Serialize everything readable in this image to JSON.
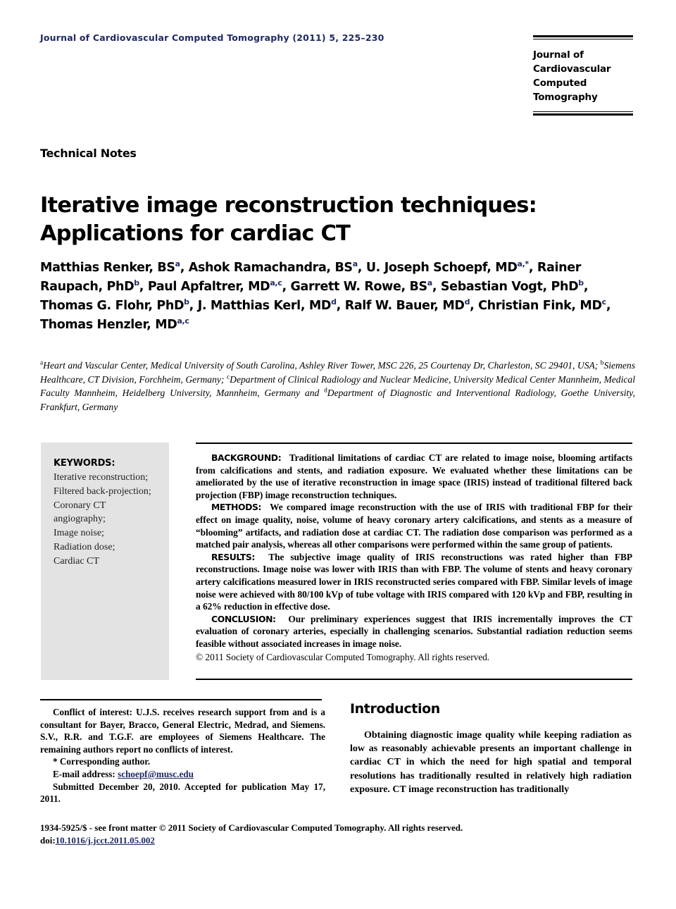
{
  "running_head": "Journal of Cardiovascular Computed Tomography (2011) 5, 225–230",
  "journal_logo": {
    "lines": [
      "Journal of",
      "Cardiovascular",
      "Computed Tomography"
    ]
  },
  "section_type": "Technical Notes",
  "title": "Iterative image reconstruction techniques: Applications for cardiac CT",
  "authors_html": "Matthias Renker, BS<sup>a</sup>, Ashok Ramachandra, BS<sup>a</sup>, U. Joseph Schoepf, MD<sup>a,</sup><sup class=\"star\">*</sup>, Rainer Raupach, PhD<sup>b</sup>, Paul Apfaltrer, MD<sup>a,c</sup>, Garrett W. Rowe, BS<sup>a</sup>, Sebastian Vogt, PhD<sup>b</sup>, Thomas G. Flohr, PhD<sup>b</sup>, J. Matthias Kerl, MD<sup>d</sup>, Ralf W. Bauer, MD<sup>d</sup>, Christian Fink, MD<sup>c</sup>, Thomas Henzler, MD<sup>a,c</sup>",
  "affiliations_html": "<sup>a</sup>Heart and Vascular Center, Medical University of South Carolina, Ashley River Tower, MSC 226, 25 Courtenay Dr, Charleston, SC 29401, USA; <sup>b</sup>Siemens Healthcare, CT Division, Forchheim, Germany; <sup>c</sup>Department of Clinical Radiology and Nuclear Medicine, University Medical Center Mannheim, Medical Faculty Mannheim, Heidelberg University, Mannheim, Germany and <sup>d</sup>Department of Diagnostic and Interventional Radiology, Goethe University, Frankfurt, Germany",
  "keywords": {
    "heading": "KEYWORDS:",
    "items": [
      "Iterative reconstruction;",
      "Filtered back-projection;",
      "Coronary CT",
      "angiography;",
      "Image noise;",
      "Radiation dose;",
      "Cardiac CT"
    ]
  },
  "abstract": {
    "sections": [
      {
        "label": "BACKGROUND:",
        "text": "Traditional limitations of cardiac CT are related to image noise, blooming artifacts from calcifications and stents, and radiation exposure. We evaluated whether these limitations can be ameliorated by the use of iterative reconstruction in image space (IRIS) instead of traditional filtered back projection (FBP) image reconstruction techniques."
      },
      {
        "label": "METHODS:",
        "text": "We compared image reconstruction with the use of IRIS with traditional FBP for their effect on image quality, noise, volume of heavy coronary artery calcifications, and stents as a measure of “blooming” artifacts, and radiation dose at cardiac CT. The radiation dose comparison was performed as a matched pair analysis, whereas all other comparisons were performed within the same group of patients."
      },
      {
        "label": "RESULTS:",
        "text": "The subjective image quality of IRIS reconstructions was rated higher than FBP reconstructions. Image noise was lower with IRIS than with FBP. The volume of stents and heavy coronary artery calcifications measured lower in IRIS reconstructed series compared with FBP. Similar levels of image noise were achieved with 80/100 kVp of tube voltage with IRIS compared with 120 kVp and FBP, resulting in a 62% reduction in effective dose."
      },
      {
        "label": "CONCLUSION:",
        "text": "Our preliminary experiences suggest that IRIS incrementally improves the CT evaluation of coronary arteries, especially in challenging scenarios. Substantial radiation reduction seems feasible without associated increases in image noise."
      }
    ],
    "copyright": "© 2011 Society of Cardiovascular Computed Tomography. All rights reserved."
  },
  "footnotes": {
    "conflict_label": "Conflict of interest:",
    "conflict_text": "U.J.S. receives research support from and is a consultant for Bayer, Bracco, General Electric, Medrad, and Siemens. S.V., R.R. and T.G.F. are employees of Siemens Healthcare. The remaining authors report no conflicts of interest.",
    "corresponding": "* Corresponding author.",
    "email_label": "E-mail address:",
    "email": "schoepf@musc.edu",
    "submitted": "Submitted December 20, 2010. Accepted for publication May 17, 2011."
  },
  "introduction": {
    "heading": "Introduction",
    "paragraph": "Obtaining diagnostic image quality while keeping radiation as low as reasonably achievable presents an important challenge in cardiac CT in which the need for high spatial and temporal resolutions has traditionally resulted in relatively high radiation exposure. CT image reconstruction has traditionally"
  },
  "page_footer": {
    "front_matter": "1934-5925/$ - see front matter © 2011 Society of Cardiovascular Computed Tomography. All rights reserved.",
    "doi_prefix": "doi:",
    "doi": "10.1016/j.jcct.2011.05.002"
  },
  "colors": {
    "accent_navy": "#1f2a63",
    "keyword_box_gray": "#e3e3e3",
    "rule_black": "#000000"
  }
}
